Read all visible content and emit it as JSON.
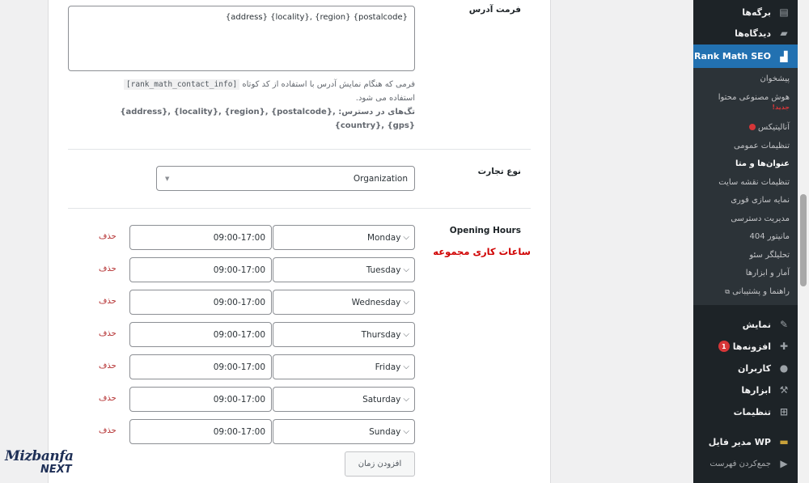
{
  "sidebar": {
    "pages": "برگه‌ها",
    "comments": "دیدگاه‌ها",
    "rankmath": "Rank Math SEO",
    "sub": {
      "proposals": "پیشخوان",
      "ai": "هوش مصنوعی محتوا",
      "ai_new": "جدید!",
      "analytics": "آنالیتیکس",
      "general": "تنظیمات عمومی",
      "titles": "عنوان‌ها و متا",
      "sitemap": "تنظیمات نقشه سایت",
      "instant": "نمایه سازی فوری",
      "roles": "مدیریت دسترسی",
      "monitor": "مانیتور 404",
      "analyzer": "تحلیلگر سئو",
      "status": "آمار و ابزارها",
      "help": "راهنما و پشتیبانی"
    },
    "appearance": "نمایش",
    "plugins": "افزونه‌ها",
    "plugins_count": "1",
    "users": "کاربران",
    "tools": "ابزارها",
    "settings": "تنظیمات",
    "wp_file": "WP مدیر فایل",
    "collapse": "جمع‌کردن فهرست"
  },
  "address_format": {
    "label": "فرمت آدرس",
    "value": "{address} {locality}, {region} {postalcode}",
    "desc_a": "فرمی که هنگام نمایش آدرس با استفاده از کد کوتاه",
    "shortcode": "[rank_math_contact_info]",
    "desc_b": "استفاده می شود.",
    "tags_label": "تگ‌های در دسترس:",
    "tags_1": "{address}, {locality}, {region}, {postalcode},",
    "tags_2": "{country}, {gps}"
  },
  "business_type": {
    "label": "نوع تجارت",
    "value": "Organization"
  },
  "opening_hours": {
    "label": "Opening Hours",
    "annotation": "ساعات کاری مجموعه",
    "rows": [
      {
        "day": "Monday",
        "time": "09:00-17:00",
        "delete": "حذف"
      },
      {
        "day": "Tuesday",
        "time": "09:00-17:00",
        "delete": "حذف"
      },
      {
        "day": "Wednesday",
        "time": "09:00-17:00",
        "delete": "حذف"
      },
      {
        "day": "Thursday",
        "time": "09:00-17:00",
        "delete": "حذف"
      },
      {
        "day": "Friday",
        "time": "09:00-17:00",
        "delete": "حذف"
      },
      {
        "day": "Saturday",
        "time": "09:00-17:00",
        "delete": "حذف"
      },
      {
        "day": "Sunday",
        "time": "09:00-17:00",
        "delete": "حذف"
      }
    ],
    "add_button": "افزودن زمان"
  },
  "logo": {
    "line1": "Mizbanfa",
    "line2": "NEXT"
  },
  "colors": {
    "admin_bar": "#1d2327",
    "active": "#2271b1",
    "danger": "#d63638",
    "annotation": "#d00000"
  }
}
